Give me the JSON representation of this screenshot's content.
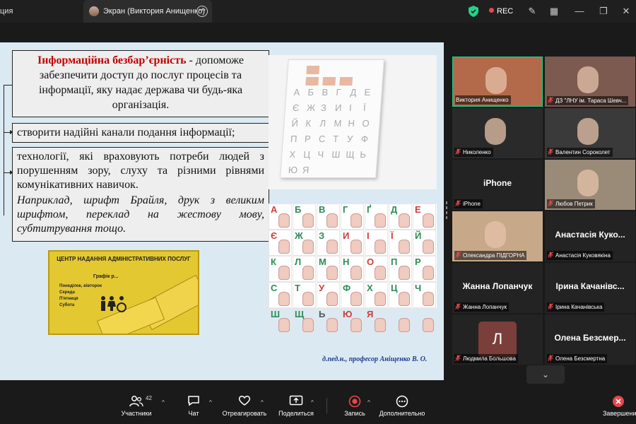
{
  "window": {
    "left_tab_label": "ция",
    "active_tab_label": "Экран (Виктория Анищенко)",
    "rec_label": "REC"
  },
  "slide": {
    "box1_title": "Інформаційна безбар’єрність",
    "box1_rest": " - допоможе забезпечити доступ до послуг процесів та інформації, яку надає держава чи будь-яка організація.",
    "box2": "створити надійні канали подання інформації;",
    "box3_main": "технології, які враховують потреби людей з порушенням зору, слуху та різними рівнями комунікативних навичок.",
    "box3_italic": "Наприклад, шрифт Брайля, друк з великим шрифтом, переклад на жестову мову, субтитрування тощо.",
    "sign_title": "ЦЕНТР НАДАННЯ АДМІНІСТРАТИВНИХ ПОСЛУГ",
    "sign_lines": [
      "Понеділок, вівторок",
      "Середа",
      "П'ятниця",
      "Субота"
    ],
    "sign_schedule": "Графік р...",
    "signature": "д.пед.н., професор Аніщенко В. О."
  },
  "board_letters": [
    "А",
    "Б",
    "В",
    "Г",
    "Д",
    "Е",
    "Є",
    "Ж",
    "З",
    "И",
    "І",
    "Ї",
    "Й",
    "К",
    "Л",
    "М",
    "Н",
    "О",
    "П",
    "Р",
    "С",
    "Т",
    "У",
    "Ф",
    "Х",
    "Ц",
    "Ч",
    "Ш",
    "Щ",
    "Ь",
    "Ю",
    "Я"
  ],
  "sign_alphabet": [
    {
      "l": "А",
      "c": "#d23a3a"
    },
    {
      "l": "Б",
      "c": "#2e8b57"
    },
    {
      "l": "В",
      "c": "#2e8b57"
    },
    {
      "l": "Г",
      "c": "#2e8b57"
    },
    {
      "l": "Ґ",
      "c": "#2e8b57"
    },
    {
      "l": "Д",
      "c": "#2e8b57"
    },
    {
      "l": "Е",
      "c": "#d23a3a"
    },
    {
      "l": "Є",
      "c": "#d23a3a"
    },
    {
      "l": "Ж",
      "c": "#2e8b57"
    },
    {
      "l": "З",
      "c": "#2e8b57"
    },
    {
      "l": "И",
      "c": "#d23a3a"
    },
    {
      "l": "І",
      "c": "#d23a3a"
    },
    {
      "l": "Ї",
      "c": "#d23a3a"
    },
    {
      "l": "Й",
      "c": "#2e8b57"
    },
    {
      "l": "К",
      "c": "#2e8b57"
    },
    {
      "l": "Л",
      "c": "#2e8b57"
    },
    {
      "l": "М",
      "c": "#2e8b57"
    },
    {
      "l": "Н",
      "c": "#2e8b57"
    },
    {
      "l": "О",
      "c": "#d23a3a"
    },
    {
      "l": "П",
      "c": "#2e8b57"
    },
    {
      "l": "Р",
      "c": "#2e8b57"
    },
    {
      "l": "С",
      "c": "#2e8b57"
    },
    {
      "l": "Т",
      "c": "#2e8b57"
    },
    {
      "l": "У",
      "c": "#d23a3a"
    },
    {
      "l": "Ф",
      "c": "#2e8b57"
    },
    {
      "l": "Х",
      "c": "#2e8b57"
    },
    {
      "l": "Ц",
      "c": "#2e8b57"
    },
    {
      "l": "Ч",
      "c": "#2e8b57"
    },
    {
      "l": "Ш",
      "c": "#2e8b57"
    },
    {
      "l": "Щ",
      "c": "#2e8b57"
    },
    {
      "l": "Ь",
      "c": "#555555"
    },
    {
      "l": "Ю",
      "c": "#d23a3a"
    },
    {
      "l": "Я",
      "c": "#d23a3a"
    },
    {
      "l": "",
      "c": "#2e8b57"
    },
    {
      "l": "",
      "c": "#2e8b57"
    }
  ],
  "participants": [
    {
      "name": "Виктория Анищенко",
      "type": "video",
      "bg": "#b36a4a",
      "active": true,
      "muted": false
    },
    {
      "name": "ДЗ \"ЛНУ ім. Тараса Шевч...",
      "type": "video",
      "bg": "#7d5a4f",
      "active": false,
      "muted": true
    },
    {
      "name": "Николенко",
      "type": "video",
      "bg": "#2a2a2a",
      "active": false,
      "muted": true
    },
    {
      "name": "Валентин Сороколет",
      "type": "video",
      "bg": "#3a3a3a",
      "active": false,
      "muted": true
    },
    {
      "name": "iPhone",
      "type": "text",
      "big": "iPhone",
      "active": false,
      "muted": true
    },
    {
      "name": "Любов Петрик",
      "type": "video",
      "bg": "#9a8a78",
      "active": false,
      "muted": true
    },
    {
      "name": "Олександра ПІДГОРНА",
      "type": "video",
      "bg": "#c7a98a",
      "active": false,
      "muted": true
    },
    {
      "name": "Анастасія Куковякіна",
      "type": "text",
      "big": "Анастасія Куко...",
      "active": false,
      "muted": true
    },
    {
      "name": "Жанна Лопанчук",
      "type": "text",
      "big": "Жанна Лопанчук",
      "active": false,
      "muted": true
    },
    {
      "name": "Ірина Качанівська",
      "type": "text",
      "big": "Ірина Качанівс...",
      "active": false,
      "muted": true
    },
    {
      "name": "Людмила Большова",
      "type": "avatar",
      "letter": "Л",
      "active": false,
      "muted": true
    },
    {
      "name": "Олена Безсмертна",
      "type": "text",
      "big": "Олена Безсмер...",
      "active": false,
      "muted": true
    }
  ],
  "toolbar": {
    "participants_label": "Участники",
    "participants_count": "42",
    "chat_label": "Чат",
    "react_label": "Отреагировать",
    "share_label": "Поделиться",
    "record_label": "Запись",
    "more_label": "Дополнительно",
    "end_label": "Завершение"
  },
  "colors": {
    "accent_green": "#23d18b",
    "rec_red": "#e5484d",
    "mic_muted": "#e5484d",
    "signature_blue": "#1f3c8f",
    "heading_red": "#c00000"
  }
}
